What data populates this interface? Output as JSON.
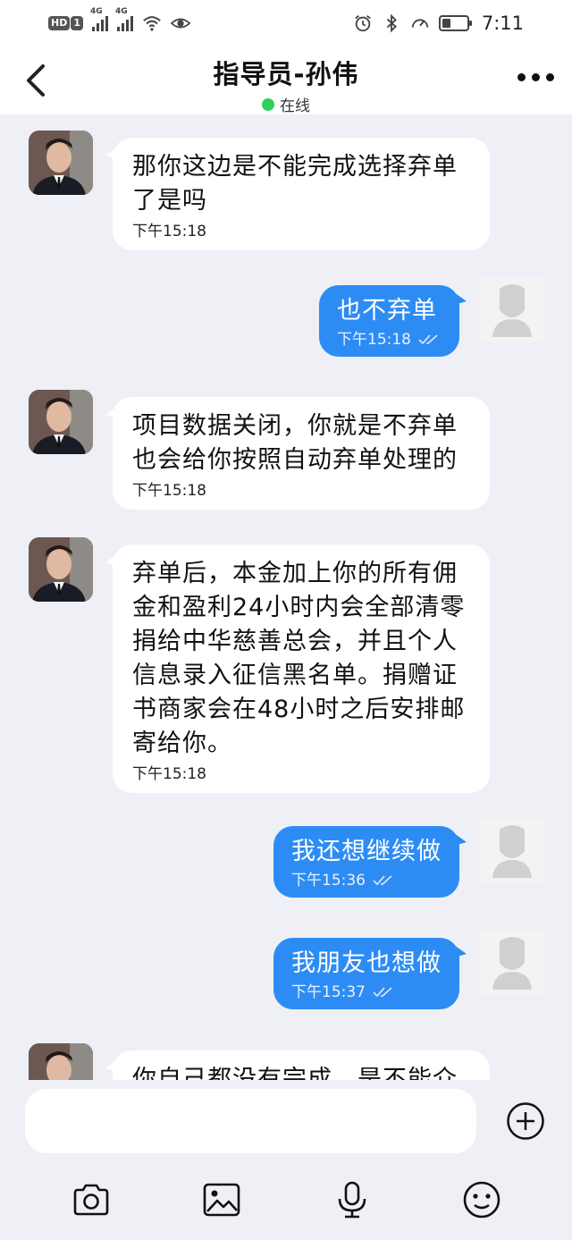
{
  "status_bar": {
    "hd_badge": "HD",
    "sim_badge": "1",
    "net1": "4G",
    "net2": "4G",
    "time": "7:11",
    "battery_level": 0.35
  },
  "header": {
    "title": "指导员-孙伟",
    "status": "在线",
    "status_color": "#2fd15b"
  },
  "colors": {
    "outgoing_bubble": "#2d8cf4",
    "incoming_bubble": "#ffffff",
    "background": "#eef0f6"
  },
  "messages": [
    {
      "from": "agent",
      "lines": [
        "那你这边是不能完成选择弃单",
        "了是吗"
      ],
      "time": "下午15:18"
    },
    {
      "from": "user",
      "text": "也不弃单",
      "time": "下午15:18",
      "read": true
    },
    {
      "from": "agent",
      "lines": [
        "项目数据关闭，你就是不弃单",
        "也会给你按照自动弃单处理的"
      ],
      "time": "下午15:18"
    },
    {
      "from": "agent",
      "lines": [
        "弃单后，本金加上你的所有佣",
        "金和盈利24小时内会全部清零",
        "捐给中华慈善总会，并且个人",
        "信息录入征信黑名单。捐赠证",
        "书商家会在48小时之后安排邮",
        "寄给你。"
      ],
      "time": "下午15:18"
    },
    {
      "from": "user",
      "text": "我还想继续做",
      "time": "下午15:36",
      "read": true
    },
    {
      "from": "user",
      "text": "我朋友也想做",
      "time": "下午15:37",
      "read": true
    },
    {
      "from": "agent",
      "lines": [
        "你自己都没有完成，是不能介"
      ],
      "time": ""
    }
  ],
  "input": {
    "placeholder": "",
    "value": ""
  },
  "toolbar": {
    "icons": [
      "camera-icon",
      "image-icon",
      "microphone-icon",
      "emoji-icon",
      "plus-icon"
    ]
  }
}
